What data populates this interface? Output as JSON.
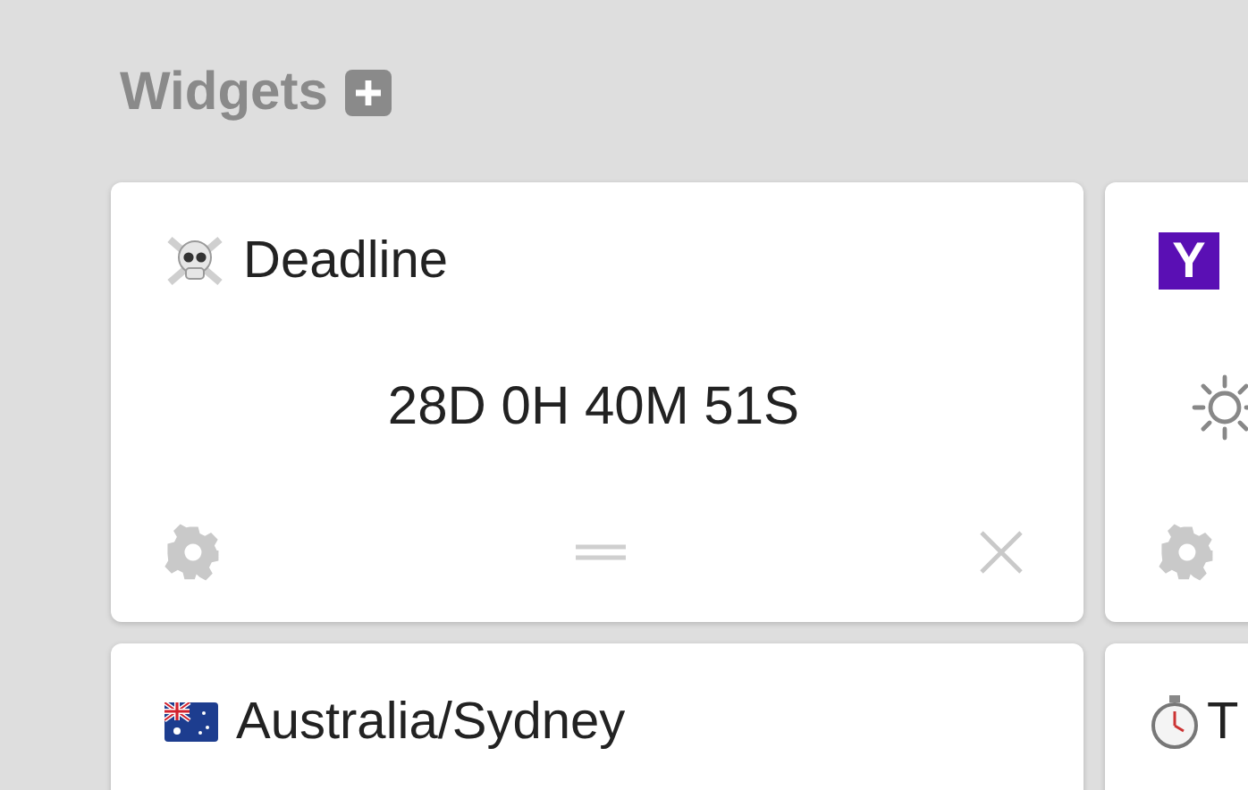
{
  "header": {
    "title": "Widgets"
  },
  "widgets": [
    {
      "kind": "countdown",
      "title": "Deadline",
      "countdown": "28D 0H 40M 51S"
    },
    {
      "kind": "weather",
      "icon_letter": "Y"
    },
    {
      "kind": "clock",
      "title": "Australia/Sydney"
    },
    {
      "kind": "timer",
      "title": "T"
    }
  ]
}
